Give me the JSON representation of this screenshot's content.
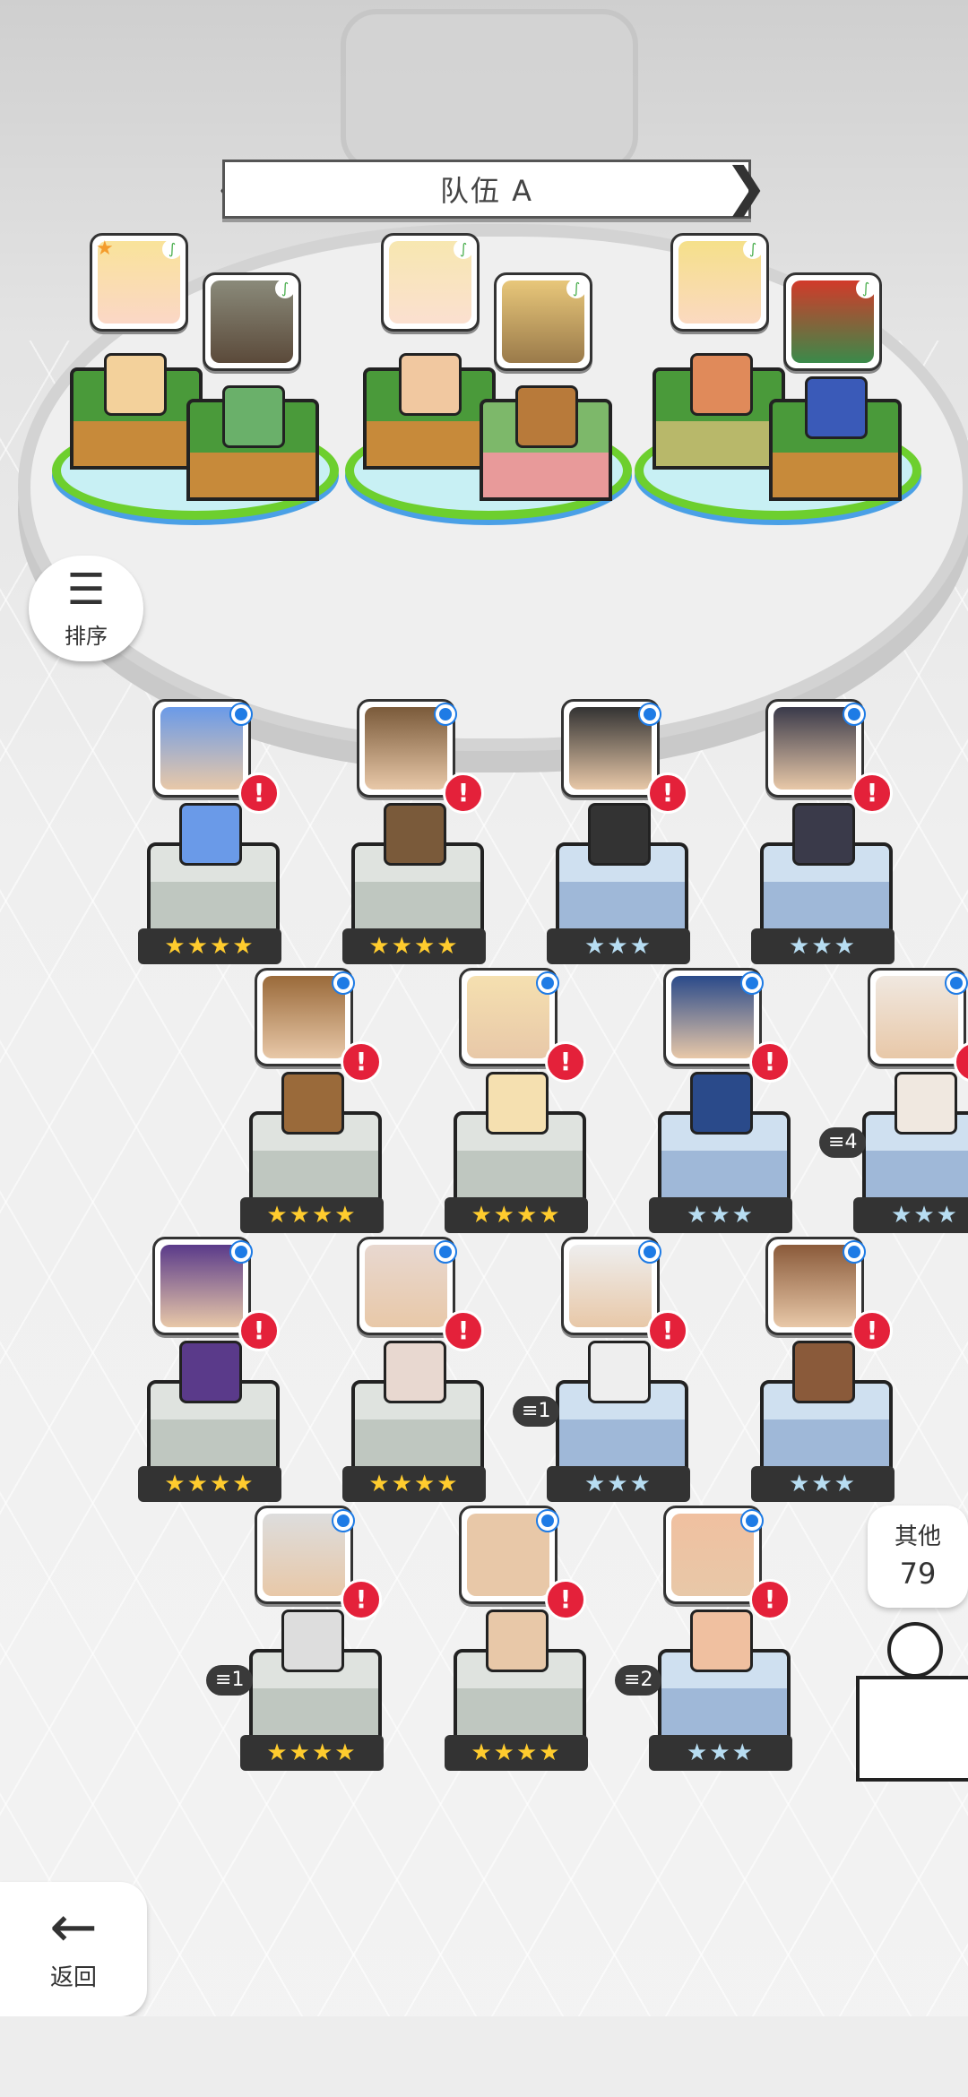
{
  "team": {
    "title": "队伍 A"
  },
  "sort_button": {
    "label": "排序"
  },
  "others": {
    "label": "其他",
    "count": "79"
  },
  "back_button": {
    "label": "返回"
  },
  "roster": [
    {
      "stars": "★★★★",
      "rank": "gold"
    },
    {
      "stars": "★★★★",
      "rank": "gold"
    },
    {
      "stars": "★★★",
      "rank": "silver"
    },
    {
      "stars": "★★★",
      "rank": "silver"
    },
    {
      "stars": "★★★★",
      "rank": "gold"
    },
    {
      "stars": "★★★★",
      "rank": "gold"
    },
    {
      "stars": "★★★",
      "rank": "silver"
    },
    {
      "stars": "★★★",
      "rank": "silver",
      "count": "4"
    },
    {
      "stars": "★★★★",
      "rank": "gold"
    },
    {
      "stars": "★★★★",
      "rank": "gold"
    },
    {
      "stars": "★★★",
      "rank": "silver",
      "count": "1"
    },
    {
      "stars": "★★★",
      "rank": "silver"
    },
    {
      "stars": "★★★★",
      "rank": "gold",
      "count": "1"
    },
    {
      "stars": "★★★★",
      "rank": "gold"
    },
    {
      "stars": "★★★",
      "rank": "silver",
      "count": "2"
    }
  ],
  "colors": {
    "accent_green": "#6dcf2e",
    "alert_red": "#e4213a",
    "badge_blue": "#1e7be5",
    "gold_star": "#ffcc2e",
    "silver_star": "#b7ddf2"
  }
}
